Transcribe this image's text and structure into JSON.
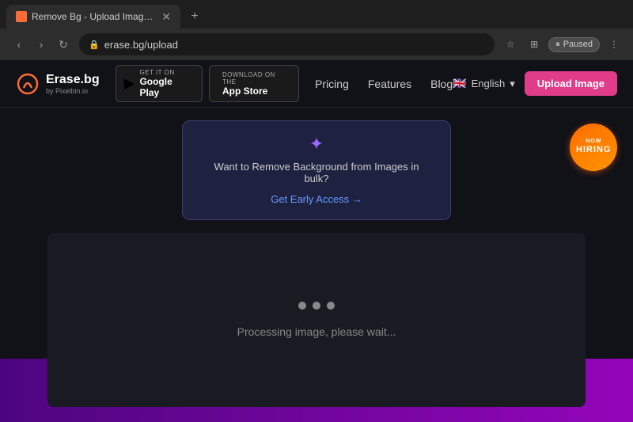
{
  "browser": {
    "tab_title": "Remove Bg - Upload Images to...",
    "url": "erase.bg/upload",
    "new_tab_label": "+",
    "paused_label": "Paused"
  },
  "navbar": {
    "logo_main": "Erase.bg",
    "logo_sub": "by Pixelbin.io",
    "google_play_get": "GET IT ON",
    "google_play_name": "Google Play",
    "app_store_get": "Download on the",
    "app_store_name": "App Store",
    "pricing": "Pricing",
    "features": "Features",
    "blog": "Blog",
    "language": "English",
    "upload_btn": "Upload Image"
  },
  "banner": {
    "text": "Want to Remove Background from Images in bulk?",
    "link_text": "Get Early Access →"
  },
  "processing": {
    "text": "Processing image, please wait..."
  },
  "hiring": {
    "now": "NOW",
    "main": "HIRING"
  }
}
